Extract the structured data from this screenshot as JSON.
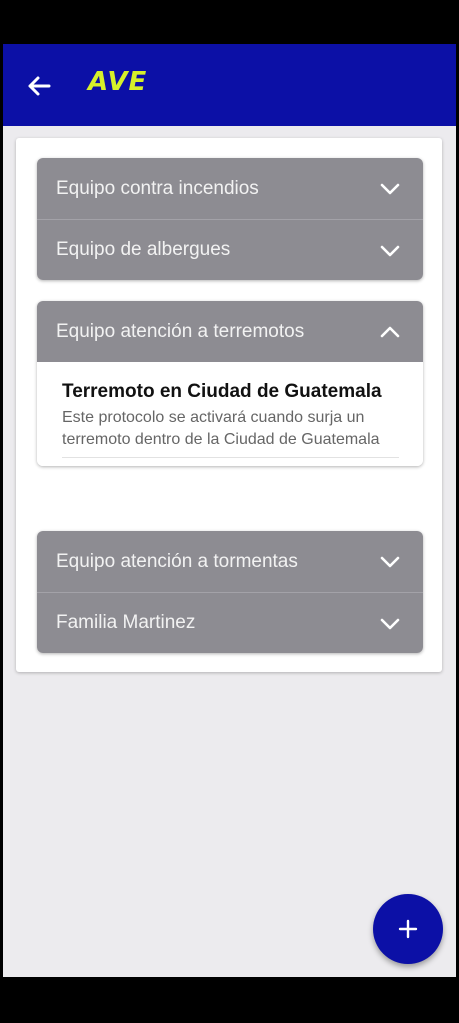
{
  "appbar": {
    "title": "AVE"
  },
  "groups": [
    {
      "label": "Equipo contra incendios",
      "expanded": false
    },
    {
      "label": "Equipo de albergues",
      "expanded": false
    },
    {
      "label": "Equipo atención a terremotos",
      "expanded": true,
      "item": {
        "title": "Terremoto en Ciudad de Guatemala",
        "description": "Este protocolo se activará cuando surja un terremoto dentro de la Ciudad de Guatemala"
      }
    },
    {
      "label": "Equipo atención a tormentas",
      "expanded": false
    },
    {
      "label": "Familia Martinez",
      "expanded": false
    }
  ],
  "colors": {
    "appbar": "#0c10a6",
    "logo": "#d6f02a",
    "group_header": "#8d8c92"
  },
  "icons": {
    "back": "arrow-left-icon",
    "collapsed": "chevron-down-icon",
    "expanded": "chevron-up-icon",
    "fab": "plus-icon"
  }
}
